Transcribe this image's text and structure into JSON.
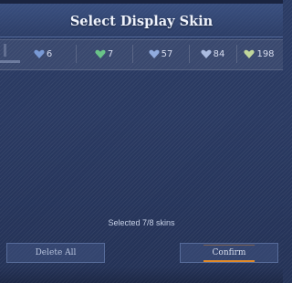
{
  "title": "Select Display Skin",
  "skins": [
    {
      "icon": "skin-heart-icon",
      "count": "6",
      "color": "#7fa2e0"
    },
    {
      "icon": "skin-heart-icon",
      "count": "7",
      "color": "#6fd08b"
    },
    {
      "icon": "skin-heart-icon",
      "count": "57",
      "color": "#9ab6ea"
    },
    {
      "icon": "skin-heart-icon",
      "count": "84",
      "color": "#b7c8ec"
    },
    {
      "icon": "skin-heart-icon",
      "count": "198",
      "color": "#cfe6a0"
    }
  ],
  "status": {
    "selected_text": "Selected 7/8 skins"
  },
  "buttons": {
    "delete_label": "Delete All",
    "confirm_label": "Confirm"
  },
  "colors": {
    "background": "#27365a",
    "accent": "#e08a2a"
  }
}
